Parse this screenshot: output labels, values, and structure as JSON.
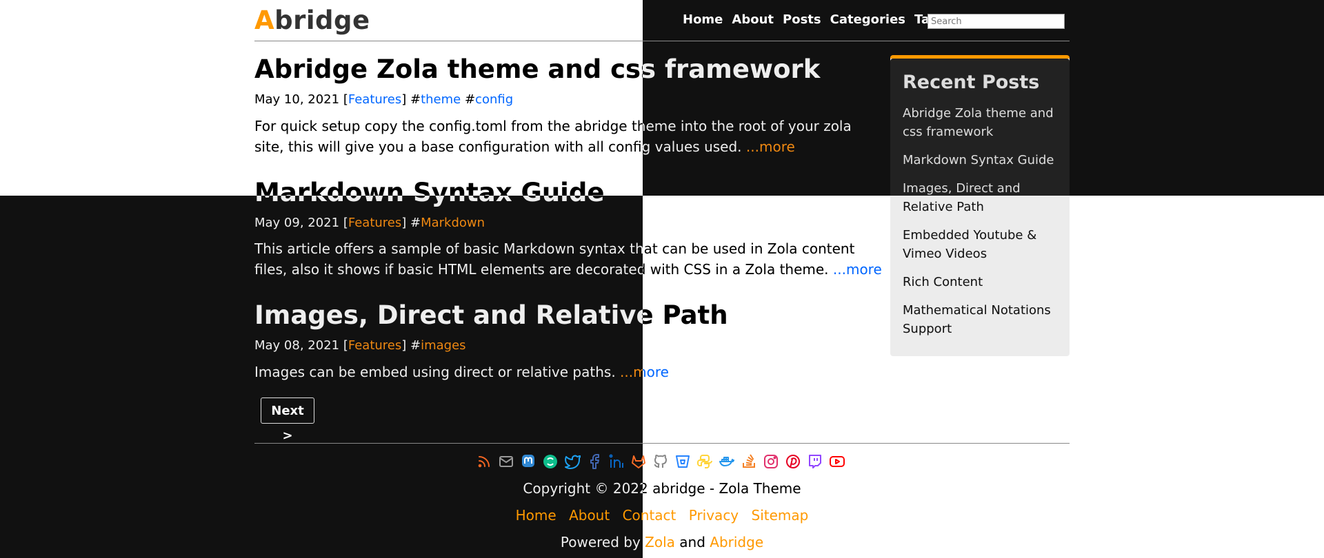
{
  "logo": {
    "first_letter": "A",
    "rest": "bridge"
  },
  "nav": [
    "Home",
    "About",
    "Posts",
    "Categories",
    "Tags"
  ],
  "search": {
    "placeholder": "Search"
  },
  "posts": [
    {
      "title": "Abridge Zola theme and css framework",
      "date": "May 10, 2021",
      "category": "Features",
      "tags": [
        "theme",
        "config"
      ],
      "excerpt": "For quick setup copy the config.toml from the abridge theme into the root of your zola site, this will give you a base configuration with all config values used.",
      "more": "...more"
    },
    {
      "title": "Markdown Syntax Guide",
      "date": "May 09, 2021",
      "category": "Features",
      "tags": [
        "Markdown"
      ],
      "excerpt": "This article offers a sample of basic Markdown syntax that can be used in Zola content files, also it shows if basic HTML elements are decorated with CSS in a Zola theme.",
      "more": "...more"
    },
    {
      "title": "Images, Direct and Relative Path",
      "date": "May 08, 2021",
      "category": "Features",
      "tags": [
        "images"
      ],
      "excerpt": "Images can be embed using direct or relative paths.",
      "more": "...more"
    }
  ],
  "pager": {
    "next": "Next >"
  },
  "sidebar": {
    "title": "Recent Posts",
    "items": [
      "Abridge Zola theme and css framework",
      "Markdown Syntax Guide",
      "Images, Direct and Relative Path",
      "Embedded Youtube & Vimeo Videos",
      "Rich Content",
      "Mathematical Notations Support"
    ]
  },
  "footer": {
    "social_icons": [
      "rss-icon",
      "mail-icon",
      "mastodon-icon",
      "matrix-icon",
      "twitter-icon",
      "facebook-icon",
      "linkedin-icon",
      "gitlab-icon",
      "github-icon",
      "bitbucket-icon",
      "python-icon",
      "docker-icon",
      "stackoverflow-icon",
      "instagram-icon",
      "pinterest-icon",
      "twitch-icon",
      "youtube-icon"
    ],
    "copyright": "Copyright © 2022 abridge - Zola Theme",
    "links": [
      "Home",
      "About",
      "Contact",
      "Privacy",
      "Sitemap"
    ],
    "powered_prefix": "Powered by",
    "powered_zola": "Zola",
    "powered_and": "and",
    "powered_abridge": "Abridge"
  },
  "colors": {
    "accent": "#FF9900",
    "dark_bg": "#111111",
    "light_bg": "#ffffff",
    "sidebar_light": "#ececec",
    "sidebar_dark": "#222222"
  }
}
